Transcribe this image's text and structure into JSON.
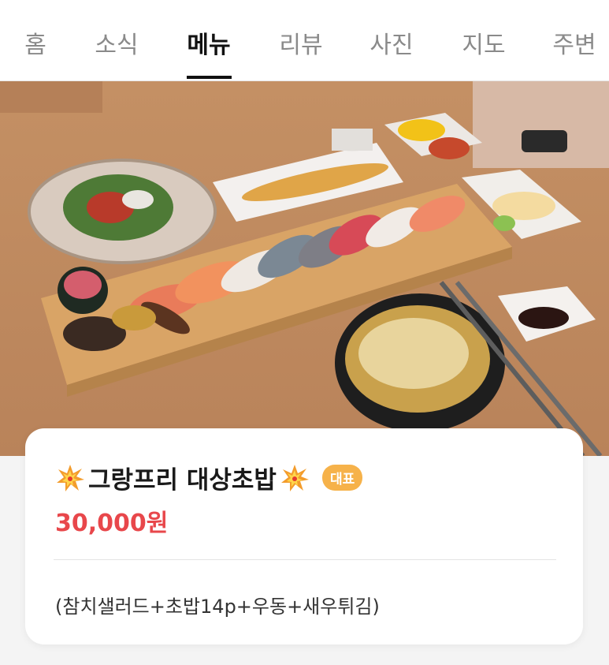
{
  "tabs": [
    {
      "label": "홈",
      "active": false
    },
    {
      "label": "소식",
      "active": false
    },
    {
      "label": "메뉴",
      "active": true
    },
    {
      "label": "리뷰",
      "active": false
    },
    {
      "label": "사진",
      "active": false
    },
    {
      "label": "지도",
      "active": false
    },
    {
      "label": "주변",
      "active": false
    }
  ],
  "menu_item": {
    "title": "그랑프리 대상초밥",
    "badge": "대표",
    "price": "30,000원",
    "description": "(참치샐러드+초밥14p+우동+새우튀김)",
    "title_icon": "collision-burst-icon"
  },
  "colors": {
    "price": "#e8474b",
    "badge": "#f6b24a",
    "active_tab": "#111111",
    "inactive_tab": "#8a8a8a"
  }
}
